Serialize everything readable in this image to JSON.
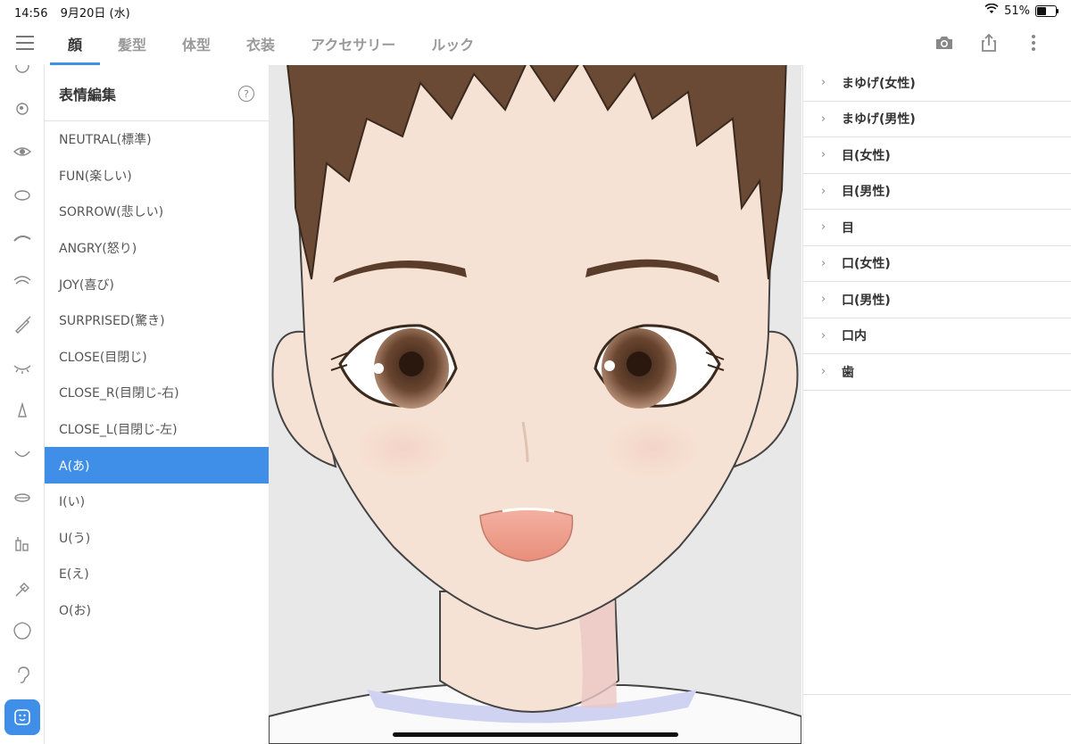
{
  "status": {
    "time": "14:56",
    "date": "9月20日 (水)",
    "battery": "51%",
    "battery_level": 0.51
  },
  "nav": {
    "tabs": [
      "顔",
      "髪型",
      "体型",
      "衣装",
      "アクセサリー",
      "ルック"
    ],
    "active_tab": "顔",
    "icons": [
      "camera-icon",
      "share-icon",
      "more-vert-icon"
    ]
  },
  "rail": {
    "icons": [
      "face-outline-icon",
      "eye-iris-icon",
      "eye-icon",
      "eye-white-icon",
      "eyebrow-icon",
      "eyelash-icon",
      "eyeliner-icon",
      "eye-closed-icon",
      "nose-icon",
      "mouth-icon",
      "lips-icon",
      "teeth-icon",
      "cheek-brush-icon",
      "face-shape-icon",
      "ear-icon",
      "expression-icon"
    ],
    "active": "expression-icon"
  },
  "expressions": {
    "title": "表情編集",
    "items": [
      "NEUTRAL(標準)",
      "FUN(楽しい)",
      "SORROW(悲しい)",
      "ANGRY(怒り)",
      "JOY(喜び)",
      "SURPRISED(驚き)",
      "CLOSE(目閉じ)",
      "CLOSE_R(目閉じ-右)",
      "CLOSE_L(目閉じ-左)",
      "A(あ)",
      "I(い)",
      "U(う)",
      "E(え)",
      "O(お)"
    ],
    "selected": "A(あ)"
  },
  "props": {
    "items": [
      "まゆげ(女性)",
      "まゆげ(男性)",
      "目(女性)",
      "目(男性)",
      "目",
      "口(女性)",
      "口(男性)",
      "口内",
      "歯"
    ]
  },
  "colors": {
    "accent": "#3f8ee8",
    "skin": "#f6e2d4",
    "hair": "#6b4a35",
    "iris": "#5a3c2a",
    "mouth": "#e99a88"
  }
}
